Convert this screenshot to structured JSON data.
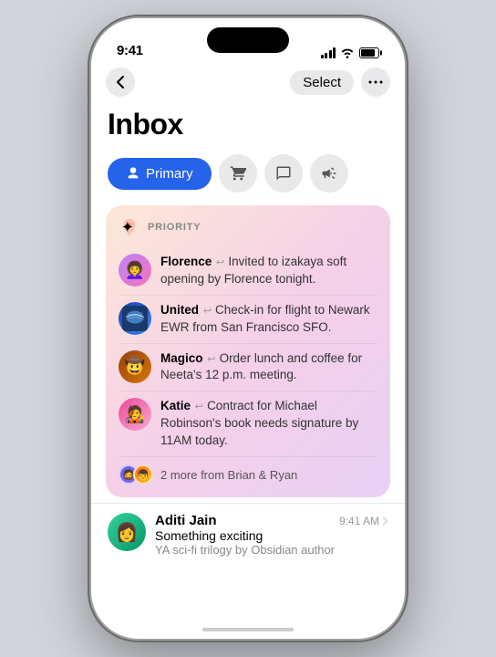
{
  "phone": {
    "status_bar": {
      "time": "9:41"
    }
  },
  "nav": {
    "back_label": "‹",
    "select_label": "Select",
    "more_label": "•••"
  },
  "page": {
    "title": "Inbox"
  },
  "tabs": [
    {
      "id": "primary",
      "label": "Primary",
      "icon": "👤",
      "active": true
    },
    {
      "id": "shopping",
      "label": "Shopping",
      "icon": "🛒",
      "active": false
    },
    {
      "id": "social",
      "label": "Social",
      "icon": "💬",
      "active": false
    },
    {
      "id": "promotions",
      "label": "Promotions",
      "icon": "📢",
      "active": false
    }
  ],
  "priority": {
    "section_label": "PRIORITY",
    "icon": "🌟",
    "items": [
      {
        "sender": "Florence",
        "body": "Invited to izakaya soft opening by Florence tonight.",
        "avatar_emoji": "👩‍🦱",
        "avatar_type": "florence"
      },
      {
        "sender": "United",
        "body": "Check-in for flight to Newark EWR from San Francisco SFO.",
        "avatar_emoji": "✈",
        "avatar_type": "united"
      },
      {
        "sender": "Magico",
        "body": "Order lunch and coffee for Neeta's 12 p.m. meeting.",
        "avatar_emoji": "🤠",
        "avatar_type": "magico"
      },
      {
        "sender": "Katie",
        "body": "Contract for Michael Robinson's book needs signature by 11AM today.",
        "avatar_emoji": "🧑‍🎤",
        "avatar_type": "katie"
      }
    ],
    "more_from": "2 more from Brian & Ryan",
    "more_avatars": [
      "🧔",
      "👦"
    ]
  },
  "emails": [
    {
      "sender": "Aditi Jain",
      "time": "9:41 AM",
      "subject": "Something exciting",
      "preview": "YA sci-fi trilogy by Obsidian author",
      "avatar_emoji": "👩"
    }
  ]
}
